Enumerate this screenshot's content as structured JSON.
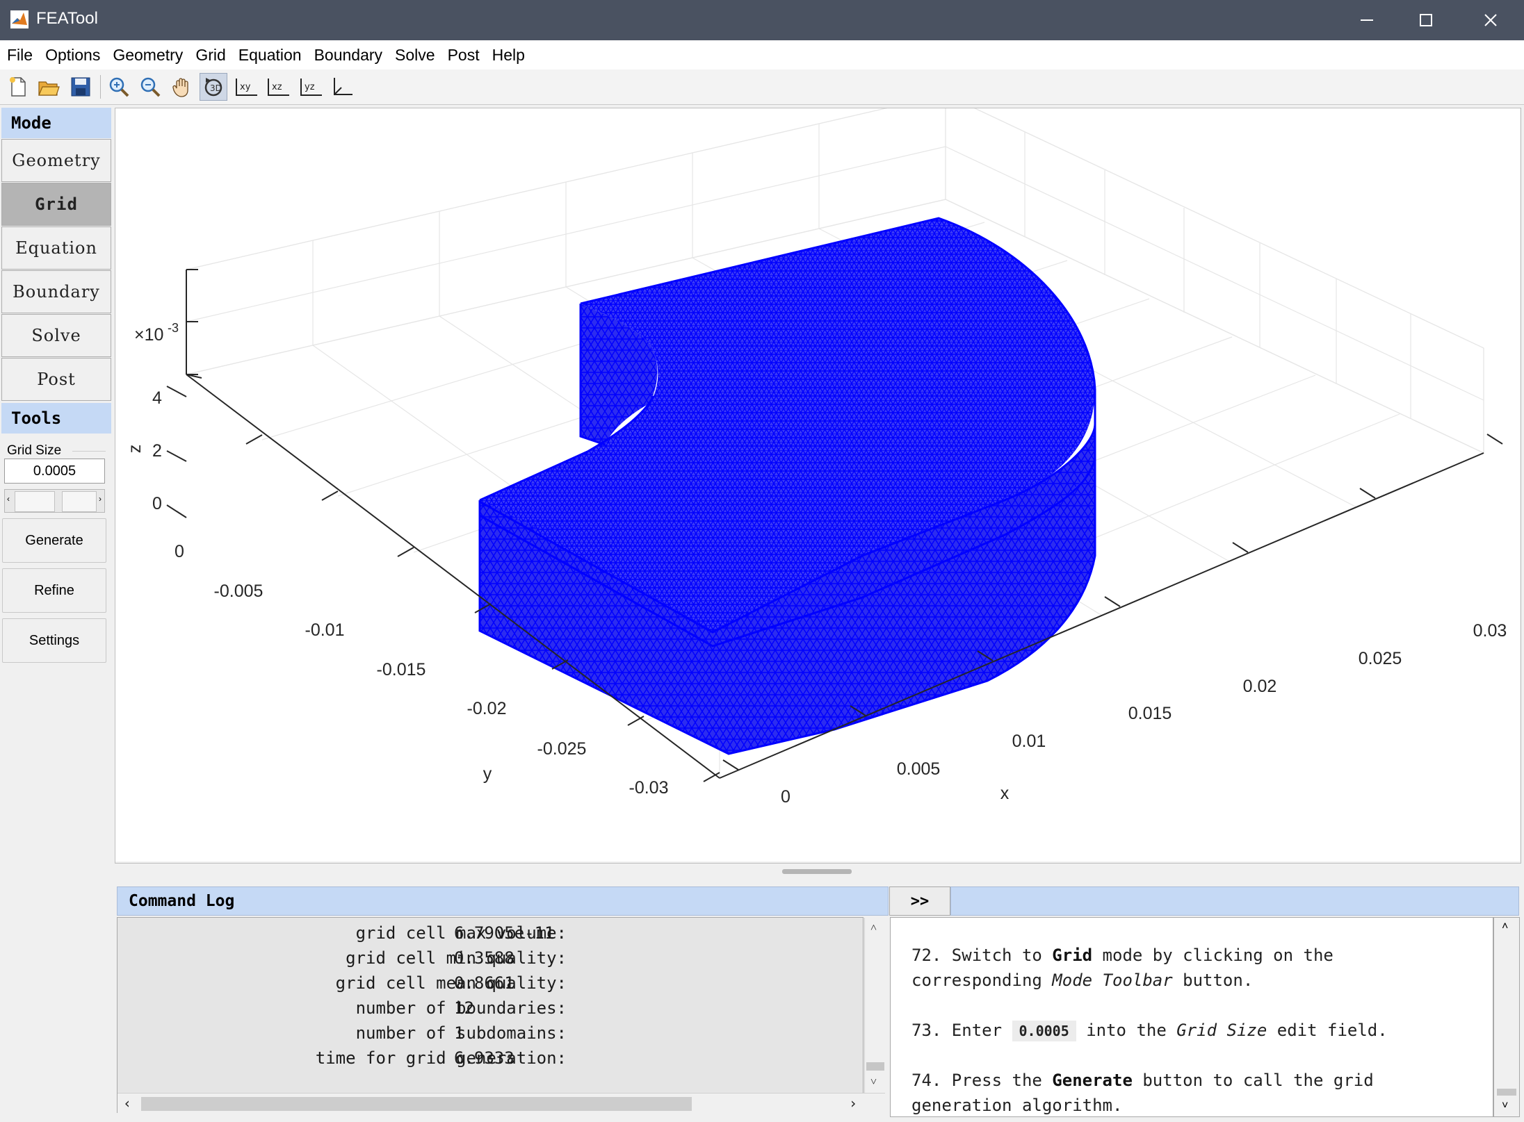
{
  "window": {
    "title": "FEATool",
    "controls": [
      "minimize",
      "maximize",
      "close"
    ]
  },
  "menu": [
    "File",
    "Options",
    "Geometry",
    "Grid",
    "Equation",
    "Boundary",
    "Solve",
    "Post",
    "Help"
  ],
  "toolbar": {
    "buttons": [
      "new-icon",
      "open-icon",
      "save-icon",
      "zoom-in-icon",
      "zoom-out-icon",
      "pan-icon",
      "rotate-icon",
      "view-xy-icon",
      "view-xz-icon",
      "view-yz-icon",
      "view-3d-icon"
    ],
    "xy": "xy",
    "xz": "xz",
    "yz": "yz"
  },
  "sidebar": {
    "mode_header": "Mode",
    "modes": [
      "Geometry",
      "Grid",
      "Equation",
      "Boundary",
      "Solve",
      "Post"
    ],
    "active_mode": "Grid",
    "tools_header": "Tools",
    "grid_size_label": "Grid Size",
    "grid_size_value": "0.0005",
    "buttons": [
      "Generate",
      "Refine",
      "Settings"
    ]
  },
  "plot": {
    "mesh_color": "#0000ff",
    "exponent_base": "×10",
    "exponent_power": "-3",
    "x_label": "x",
    "y_label": "y",
    "z_label": "z",
    "x_ticks": [
      "0",
      "0.005",
      "0.01",
      "0.015",
      "0.02",
      "0.025",
      "0.03"
    ],
    "y_ticks": [
      "0",
      "-0.005",
      "-0.01",
      "-0.015",
      "-0.02",
      "-0.025",
      "-0.03"
    ],
    "z_ticks": [
      "0",
      "2",
      "4"
    ]
  },
  "log": {
    "header": "Command Log",
    "toggle": ">>",
    "lines": [
      {
        "label": "grid cell max volume:",
        "value": "6.7905e-11"
      },
      {
        "label": "grid cell min quality:",
        "value": "0.3588"
      },
      {
        "label": "grid cell mean quality:",
        "value": "0.8661"
      },
      {
        "label": "number of boundaries:",
        "value": "12"
      },
      {
        "label": "number of subdomains:",
        "value": "1"
      },
      {
        "label": "time for grid generation:",
        "value": "6.9333"
      }
    ]
  },
  "instructions": {
    "s72_a": "72. Switch to ",
    "s72_b": "Grid",
    "s72_c": " mode by clicking on the",
    "s72_d": "corresponding ",
    "s72_e": "Mode Toolbar",
    "s72_f": " button.",
    "s73_a": "73. Enter ",
    "s73_b": "0.0005",
    "s73_c": " into the ",
    "s73_d": "Grid Size",
    "s73_e": " edit field.",
    "s74_a": "74. Press the ",
    "s74_b": "Generate",
    "s74_c": " button to call the grid",
    "s74_d": "generation algorithm."
  }
}
